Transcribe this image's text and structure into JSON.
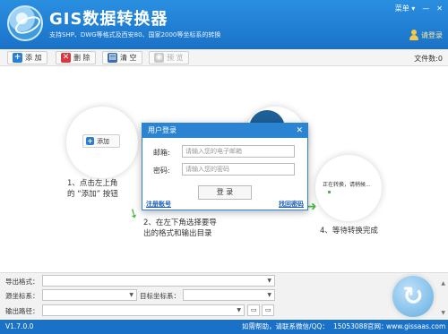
{
  "header": {
    "title": "GIS数据转换器",
    "subtitle": "支持SHP、DWG等格式及西安80、国家2000等坐标系的转换",
    "menu_label": "菜单",
    "menu_caret": "▾",
    "minimize": "—",
    "close": "✕",
    "login_label": "请登录"
  },
  "toolbar": {
    "add_label": "添 加",
    "delete_label": "删 除",
    "clear_label": "清 空",
    "preview_label": "预 览",
    "file_count": "文件数:0"
  },
  "guide": {
    "demo_add_label": "添加",
    "step1_line1": "1、点击左上角",
    "step1_line2": "的 “添加” 按钮",
    "step2_line1": "2、在左下角选择要导",
    "step2_line2": "出的格式和输出目录",
    "step4": "4、等待转换完成",
    "converting_text": "正在转换，请稍候..."
  },
  "dialog": {
    "title": "用户登录",
    "close": "✕",
    "email_label": "邮箱:",
    "email_placeholder": "请输入您的电子邮箱",
    "password_label": "密码:",
    "password_placeholder": "请输入您的密码",
    "login_button": "登 录",
    "register_link": "注册账号",
    "forgot_link": "找回密码"
  },
  "form": {
    "export_format_label": "导出格式：",
    "source_crs_label": "源坐标系：",
    "target_crs_label": "目标坐标系：",
    "output_path_label": "输出路径："
  },
  "status": {
    "version": "V1.7.0.0",
    "help_text": "如需帮助，请联系微信/QQ：",
    "contact_number": "15053088",
    "website_label": "官网：",
    "website": "www.gissaas.com"
  }
}
